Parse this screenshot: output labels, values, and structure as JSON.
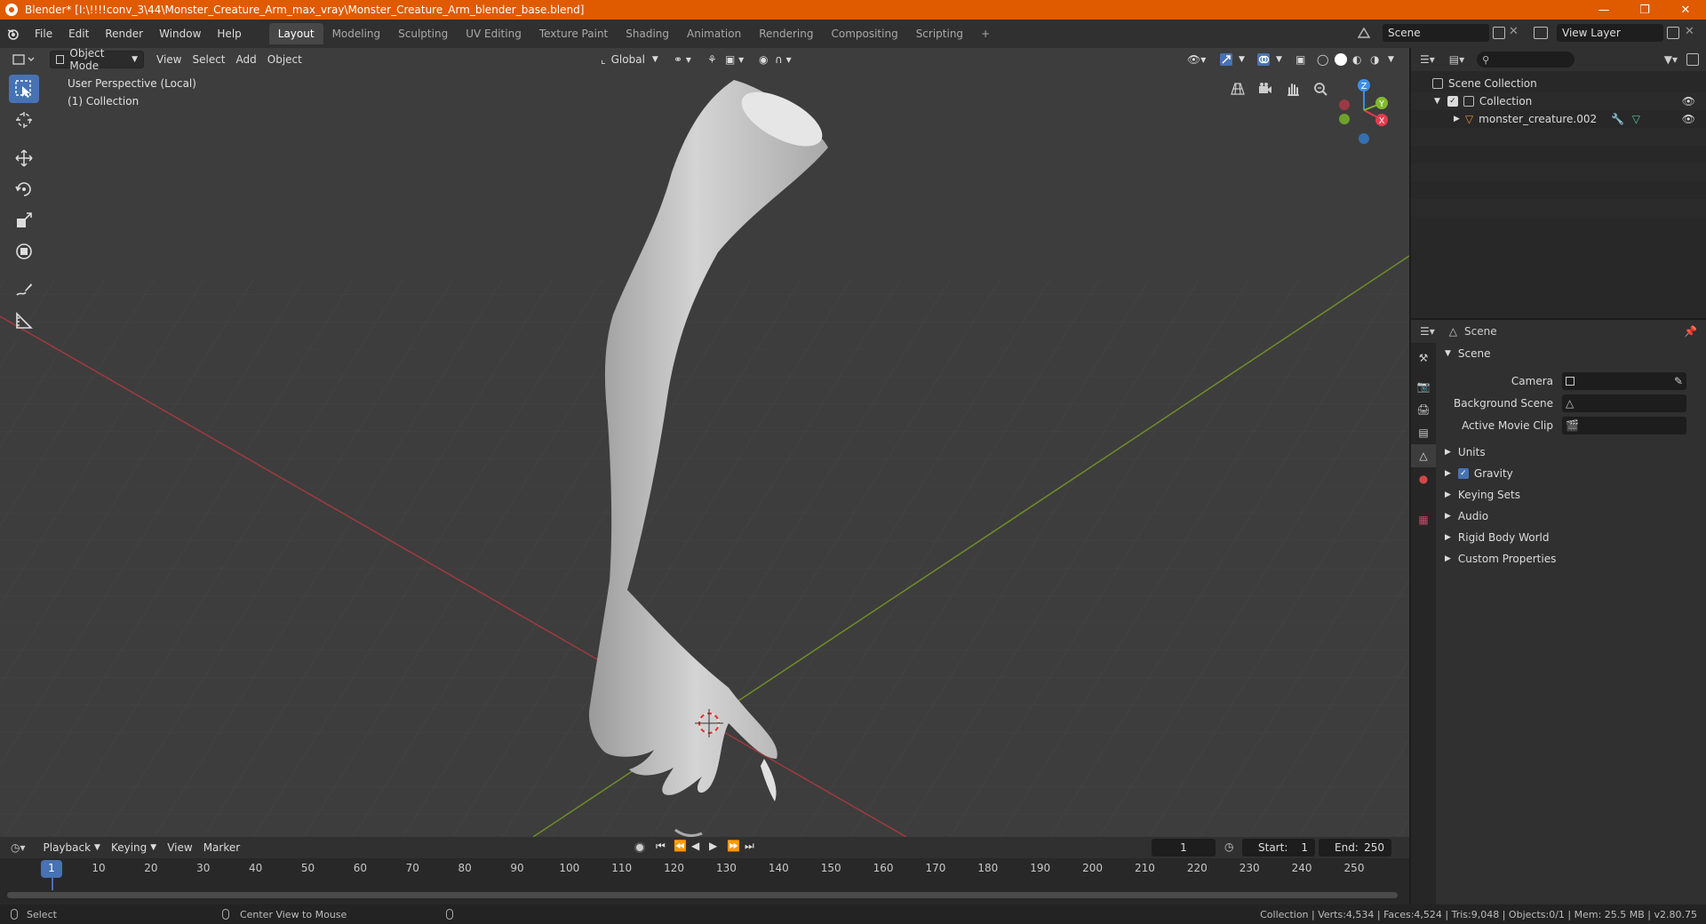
{
  "title": "Blender* [I:\\!!!!conv_3\\44\\Monster_Creature_Arm_max_vray\\Monster_Creature_Arm_blender_base.blend]",
  "menu": [
    "File",
    "Edit",
    "Render",
    "Window",
    "Help"
  ],
  "workspaces": [
    "Layout",
    "Modeling",
    "Sculpting",
    "UV Editing",
    "Texture Paint",
    "Shading",
    "Animation",
    "Rendering",
    "Compositing",
    "Scripting"
  ],
  "add_workspace": "+",
  "scene_name": "Scene",
  "view_layer": "View Layer",
  "viewport": {
    "mode": "Object Mode",
    "menus": [
      "View",
      "Select",
      "Add",
      "Object"
    ],
    "transform_orientation": "Global",
    "perspective_label": "User Perspective (Local)",
    "collection_label": "(1) Collection",
    "gizmo_axes": {
      "x": "X",
      "y": "Y",
      "z": "Z"
    }
  },
  "outliner": {
    "scene_collection": "Scene Collection",
    "collection": "Collection",
    "object": "monster_creature.002"
  },
  "properties": {
    "header_title": "Scene",
    "panel_title": "Scene",
    "rows": [
      {
        "label": "Camera",
        "value": ""
      },
      {
        "label": "Background Scene",
        "value": ""
      },
      {
        "label": "Active Movie Clip",
        "value": ""
      }
    ],
    "subpanels": [
      "Units",
      "Gravity",
      "Keying Sets",
      "Audio",
      "Rigid Body World",
      "Custom Properties"
    ],
    "gravity_checked": true
  },
  "timeline": {
    "menus": [
      "Playback",
      "Keying",
      "View",
      "Marker"
    ],
    "current_frame": "1",
    "start_label": "Start:",
    "start": "1",
    "end_label": "End:",
    "end": "250",
    "ticks": [
      "1",
      "10",
      "20",
      "30",
      "40",
      "50",
      "60",
      "70",
      "80",
      "90",
      "100",
      "110",
      "120",
      "130",
      "140",
      "150",
      "160",
      "170",
      "180",
      "190",
      "200",
      "210",
      "220",
      "230",
      "240",
      "250"
    ]
  },
  "status": {
    "left_action": "Select",
    "middle_action": "Center View to Mouse",
    "stats": "Collection | Verts:4,534 | Faces:4,524 | Tris:9,048 | Objects:0/1 | Mem: 25.5 MB | v2.80.75"
  },
  "colors": {
    "titlebar": "#e05a00",
    "active_tool": "#4772b3",
    "x_axis": "#e63b4e",
    "y_axis": "#82b82d",
    "z_axis": "#3d8ee6"
  }
}
